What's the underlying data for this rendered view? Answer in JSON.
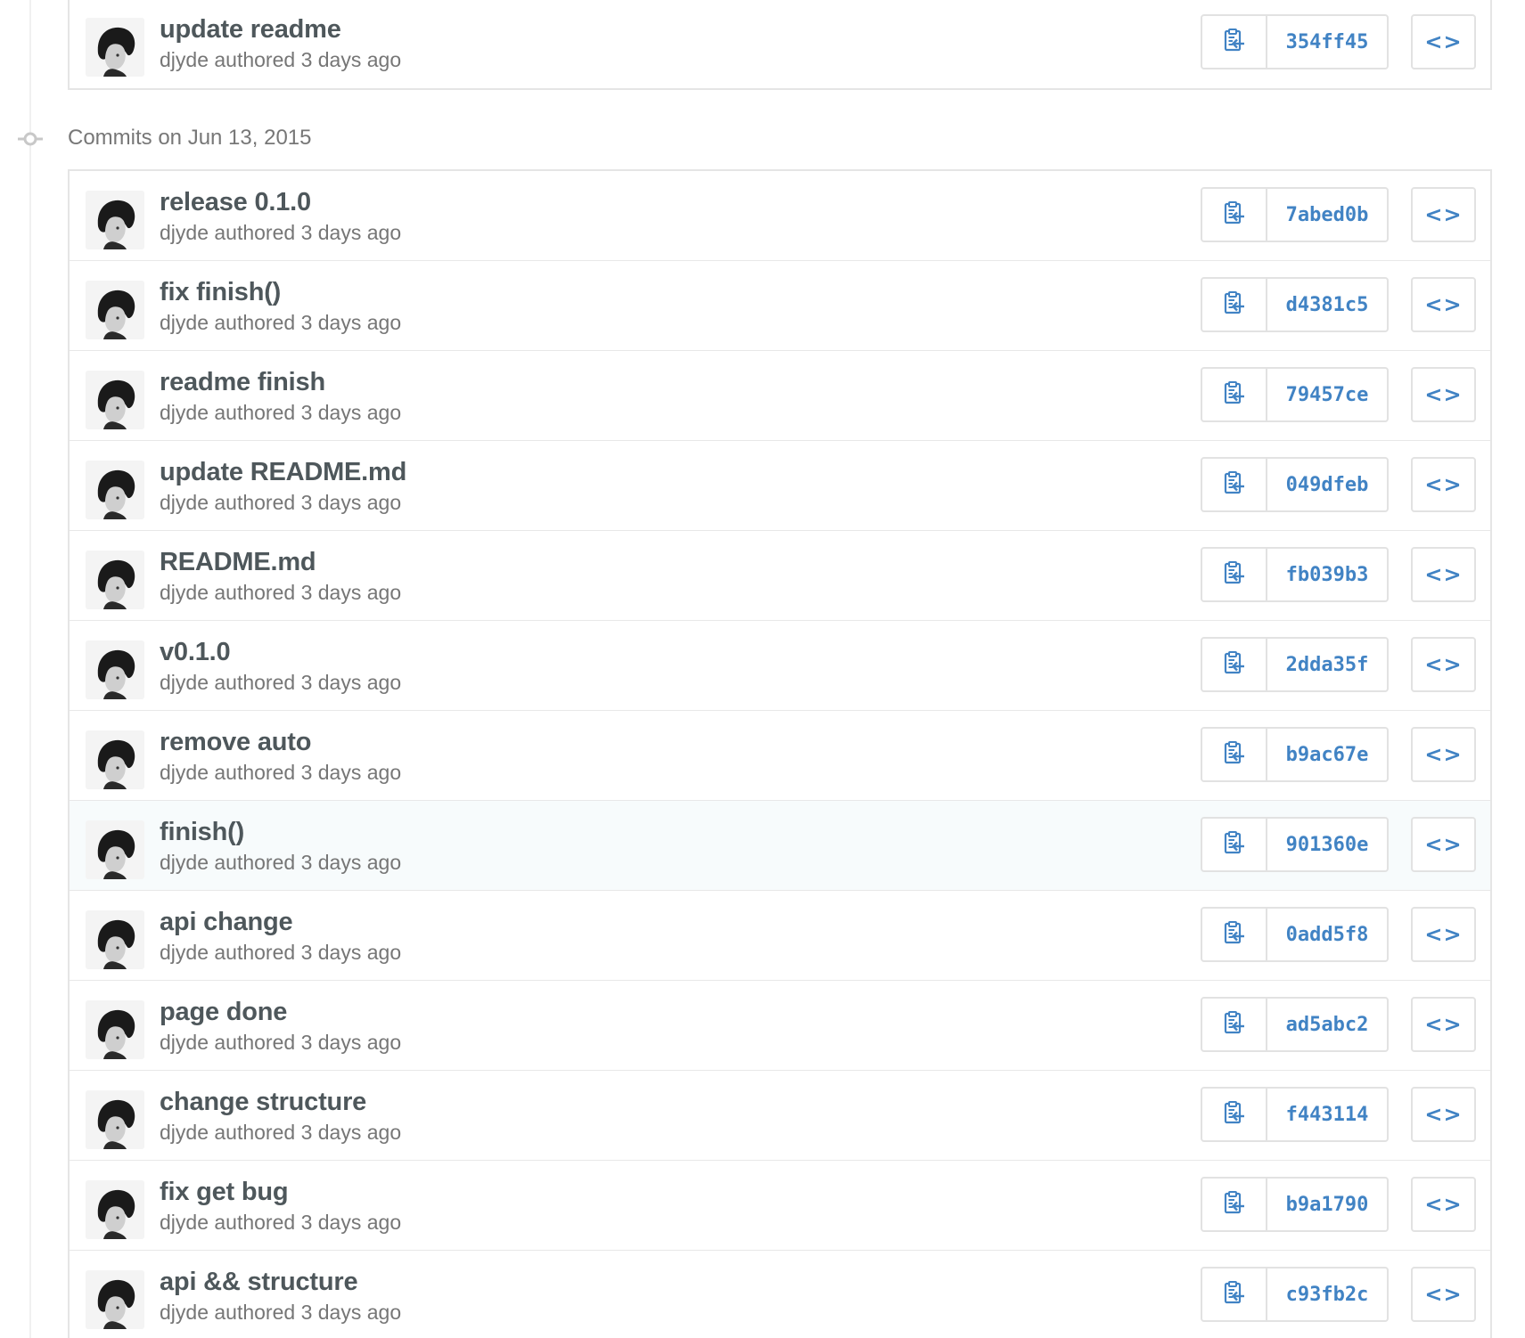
{
  "top_group": {
    "commits": [
      {
        "message": "update readme",
        "author": "djyde",
        "verb": "authored",
        "time": "3 days ago",
        "sha": "354ff45"
      }
    ]
  },
  "date_group": {
    "header": "Commits on Jun 13, 2015",
    "commits": [
      {
        "message": "release 0.1.0",
        "author": "djyde",
        "verb": "authored",
        "time": "3 days ago",
        "sha": "7abed0b"
      },
      {
        "message": "fix finish()",
        "author": "djyde",
        "verb": "authored",
        "time": "3 days ago",
        "sha": "d4381c5"
      },
      {
        "message": "readme finish",
        "author": "djyde",
        "verb": "authored",
        "time": "3 days ago",
        "sha": "79457ce"
      },
      {
        "message": "update README.md",
        "author": "djyde",
        "verb": "authored",
        "time": "3 days ago",
        "sha": "049dfeb"
      },
      {
        "message": "README.md",
        "author": "djyde",
        "verb": "authored",
        "time": "3 days ago",
        "sha": "fb039b3"
      },
      {
        "message": "v0.1.0",
        "author": "djyde",
        "verb": "authored",
        "time": "3 days ago",
        "sha": "2dda35f"
      },
      {
        "message": "remove auto",
        "author": "djyde",
        "verb": "authored",
        "time": "3 days ago",
        "sha": "b9ac67e"
      },
      {
        "message": "finish()",
        "author": "djyde",
        "verb": "authored",
        "time": "3 days ago",
        "sha": "901360e"
      },
      {
        "message": "api change",
        "author": "djyde",
        "verb": "authored",
        "time": "3 days ago",
        "sha": "0add5f8"
      },
      {
        "message": "page done",
        "author": "djyde",
        "verb": "authored",
        "time": "3 days ago",
        "sha": "ad5abc2"
      },
      {
        "message": "change structure",
        "author": "djyde",
        "verb": "authored",
        "time": "3 days ago",
        "sha": "f443114"
      },
      {
        "message": "fix get bug",
        "author": "djyde",
        "verb": "authored",
        "time": "3 days ago",
        "sha": "b9a1790"
      },
      {
        "message": "api && structure",
        "author": "djyde",
        "verb": "authored",
        "time": "3 days ago",
        "sha": "c93fb2c"
      }
    ]
  },
  "icons": {
    "copy": "clippy-icon",
    "browse": "code-icon",
    "commit_dot": "git-commit-icon"
  },
  "browse_label": "<>",
  "colors": {
    "link": "#4183c4",
    "title": "#4e575b",
    "meta": "#767676",
    "border": "#e2e2e2",
    "highlight_row": "#f7fbfc"
  }
}
